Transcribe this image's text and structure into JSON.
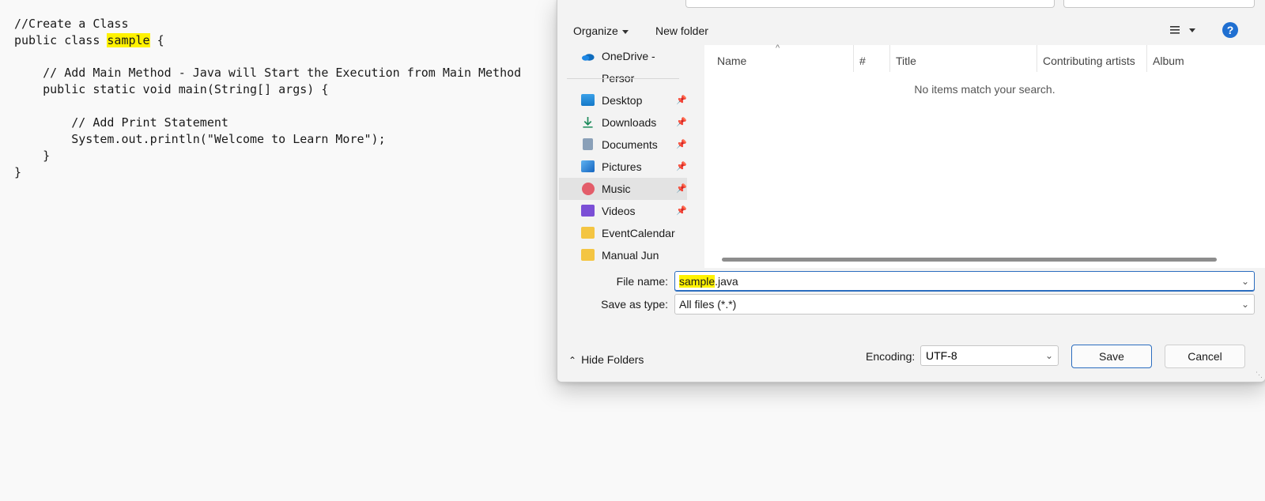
{
  "editor": {
    "lines": [
      {
        "text": "//Create a Class"
      },
      {
        "pre": "public class ",
        "hl": "sample",
        "post": " {"
      },
      {
        "text": ""
      },
      {
        "text": "    // Add Main Method - Java will Start the Execution from Main Method"
      },
      {
        "text": "    public static void main(String[] args) {"
      },
      {
        "text": ""
      },
      {
        "text": "        // Add Print Statement"
      },
      {
        "text": "        System.out.println(\"Welcome to Learn More\");"
      },
      {
        "text": "    }"
      },
      {
        "text": "}"
      }
    ],
    "highlight_color": "#fff200"
  },
  "dialog": {
    "toolbar": {
      "organize_label": "Organize",
      "new_folder_label": "New folder",
      "view_icon": "list-view-icon",
      "help_icon": "help-icon"
    },
    "nav": {
      "items": [
        {
          "label": "OneDrive - Persor",
          "icon": "onedrive-icon",
          "pinned": false
        },
        {
          "label": "Desktop",
          "icon": "desktop-icon",
          "pinned": true
        },
        {
          "label": "Downloads",
          "icon": "downloads-icon",
          "pinned": true
        },
        {
          "label": "Documents",
          "icon": "documents-icon",
          "pinned": true
        },
        {
          "label": "Pictures",
          "icon": "pictures-icon",
          "pinned": true
        },
        {
          "label": "Music",
          "icon": "music-icon",
          "pinned": true,
          "selected": true
        },
        {
          "label": "Videos",
          "icon": "videos-icon",
          "pinned": true
        },
        {
          "label": "EventCalendar",
          "icon": "folder-icon",
          "pinned": false
        },
        {
          "label": "Manual Jun",
          "icon": "folder-icon",
          "pinned": false
        }
      ]
    },
    "list": {
      "columns": [
        "Name",
        "#",
        "Title",
        "Contributing artists",
        "Album"
      ],
      "empty_message": "No items match your search."
    },
    "form": {
      "file_name_label": "File name:",
      "file_name_highlight": "sample",
      "file_name_rest": ".java",
      "save_type_label": "Save as type:",
      "save_type_value": "All files  (*.*)"
    },
    "footer": {
      "hide_folders_label": "Hide Folders",
      "encoding_label": "Encoding:",
      "encoding_value": "UTF-8",
      "save_label": "Save",
      "cancel_label": "Cancel"
    },
    "accent_color": "#2b6dbf"
  }
}
